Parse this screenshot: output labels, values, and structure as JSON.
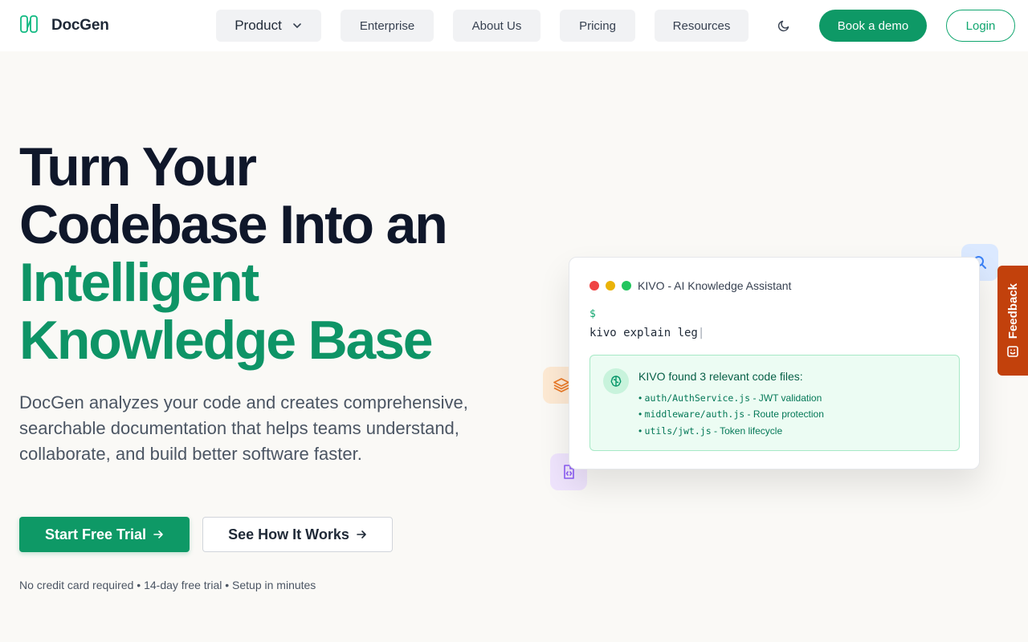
{
  "brand": {
    "name": "DocGen"
  },
  "nav": {
    "product": "Product",
    "enterprise": "Enterprise",
    "about": "About Us",
    "pricing": "Pricing",
    "resources": "Resources"
  },
  "actions": {
    "demo": "Book a demo",
    "login": "Login"
  },
  "hero": {
    "line1": "Turn Your",
    "line2": "Codebase Into an",
    "line3": "Intelligent",
    "line4": "Knowledge Base",
    "description": "DocGen analyzes your code and creates comprehensive, searchable documentation that helps teams understand, collaborate, and build better software faster.",
    "cta_primary": "Start Free Trial",
    "cta_secondary": "See How It Works",
    "note": "No credit card required • 14-day free trial • Setup in minutes"
  },
  "terminal": {
    "title": "KIVO - AI Knowledge Assistant",
    "prompt": "$",
    "command": "kivo explain leg",
    "caret": "|",
    "result_title": "KIVO found 3 relevant code files:",
    "files": [
      {
        "path": "auth/AuthService.js",
        "desc": "JWT validation"
      },
      {
        "path": "middleware/auth.js",
        "desc": "Route protection"
      },
      {
        "path": "utils/jwt.js",
        "desc": "Token lifecycle"
      }
    ]
  },
  "feedback": {
    "label": "Feedback"
  },
  "colors": {
    "brand_green": "#0e9966",
    "headline_green": "#0e9466",
    "feedback_orange": "#c2410c",
    "dot_red": "#ef4444",
    "dot_yellow": "#eab308",
    "dot_green": "#22c55e"
  },
  "icons": {
    "logo": "docgen-logo-icon",
    "product_chevron": "chevron-down-icon",
    "theme": "moon-icon",
    "arrow": "arrow-right-icon",
    "search": "search-icon",
    "layers": "layers-icon",
    "code_file": "code-file-icon",
    "brain": "brain-icon",
    "feedback": "smile-icon"
  }
}
